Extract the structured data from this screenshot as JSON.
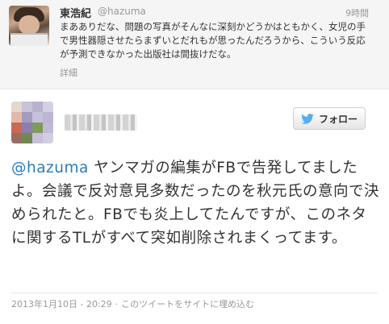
{
  "parent_tweet": {
    "name": "東浩紀",
    "handle": "@hazuma",
    "time": "9時間",
    "text": "まあありだな、問題の写真がそんなに深刻かどうかはともかく、女児の手で男性器隠させたらまずいとだれもが思ったんだろうから、こういう反応が予測できなかった出版社は間抜けだな。",
    "detail_link": "詳細"
  },
  "main_tweet": {
    "follow_button_label": "フォロー",
    "mention": "@hazuma",
    "text": " ヤンマガの編集がFBで告発してましたよ。会議で反対意見多数だったのを秋元氏の意向で決められたと。FBでも炎上してたんですが、このネタに関するTLがすべて突如削除されまくってます。",
    "timestamp": "2013年1月10日 - 20:29",
    "separator": "·",
    "embed_link": "このツイートをサイトに埋め込む"
  },
  "colors": {
    "link_blue": "#2b7bb9",
    "twitter_bird": "#55acee",
    "muted_text": "#999999"
  },
  "avatar_mosaic": [
    "#e3d7ce",
    "#c9c2d8",
    "#b9b2ce",
    "#d6cfe2",
    "#e2b9a6",
    "#a39cc0",
    "#c7c0dd",
    "#bdb5d3",
    "#c96a55",
    "#8b7fae",
    "#7f9a5a",
    "#c2bbd7",
    "#9a6d5f",
    "#6f8a4c",
    "#c8c0da",
    "#d3cde0"
  ]
}
